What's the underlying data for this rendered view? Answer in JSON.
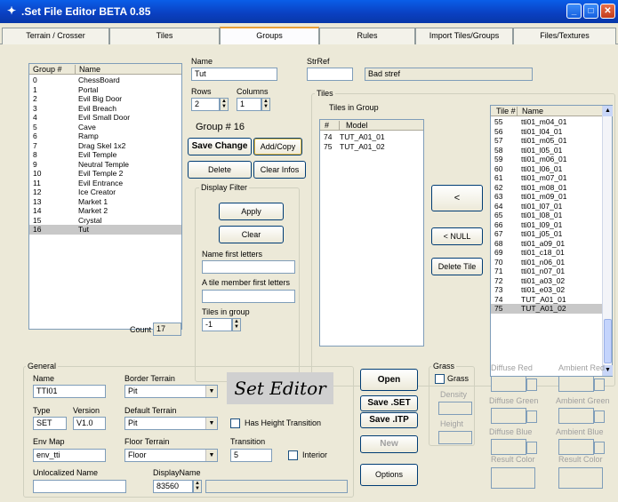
{
  "window": {
    "title": ".Set File Editor BETA 0.85",
    "app_icon": "wizard-icon"
  },
  "tabs": [
    "Terrain / Crosser",
    "Tiles",
    "Groups",
    "Rules",
    "Import Tiles/Groups",
    "Files/Textures"
  ],
  "groups": {
    "col_num": "Group #",
    "col_name": "Name",
    "rows": [
      [
        "0",
        "ChessBoard"
      ],
      [
        "1",
        "Portal"
      ],
      [
        "2",
        "Evil Big Door"
      ],
      [
        "3",
        "Evil Breach"
      ],
      [
        "4",
        "Evil Small Door"
      ],
      [
        "5",
        "Cave"
      ],
      [
        "6",
        "Ramp"
      ],
      [
        "7",
        "Drag Skel 1x2"
      ],
      [
        "8",
        "Evil Temple"
      ],
      [
        "9",
        "Neutral Temple"
      ],
      [
        "10",
        "Evil Temple 2"
      ],
      [
        "11",
        "Evil Entrance"
      ],
      [
        "12",
        "Ice Creator"
      ],
      [
        "13",
        "Market 1"
      ],
      [
        "14",
        "Market 2"
      ],
      [
        "15",
        "Crystal"
      ],
      [
        "16",
        "Tut"
      ]
    ],
    "count_label": "Count",
    "count": "17"
  },
  "edit": {
    "name_label": "Name",
    "name": "Tut",
    "strref_label": "StrRef",
    "strref": "",
    "strref_text": "Bad stref",
    "rows_label": "Rows",
    "rows": "2",
    "cols_label": "Columns",
    "cols": "1",
    "group_num": "Group # 16",
    "save_change": "Save Change",
    "add_copy": "Add/Copy",
    "delete": "Delete",
    "clear_infos": "Clear Infos"
  },
  "filter": {
    "title": "Display Filter",
    "apply": "Apply",
    "clear": "Clear",
    "name_first_label": "Name first letters",
    "member_label": "A tile member first letters",
    "tiles_in_group_label": "Tiles in group",
    "tiles_in_group": "-1"
  },
  "tiles": {
    "title": "Tiles",
    "in_group_title": "Tiles in Group",
    "col_num": "#",
    "col_model": "Model",
    "in_group": [
      [
        "74",
        "TUT_A01_01"
      ],
      [
        "75",
        "TUT_A01_02"
      ]
    ],
    "btn_add": "<",
    "btn_null": "< NULL",
    "btn_delete": "Delete Tile",
    "all_col_num": "Tile #",
    "all_col_name": "Name",
    "all": [
      [
        "55",
        "tti01_m04_01"
      ],
      [
        "56",
        "tti01_l04_01"
      ],
      [
        "57",
        "tti01_m05_01"
      ],
      [
        "58",
        "tti01_l05_01"
      ],
      [
        "59",
        "tti01_m06_01"
      ],
      [
        "60",
        "tti01_l06_01"
      ],
      [
        "61",
        "tti01_m07_01"
      ],
      [
        "62",
        "tti01_m08_01"
      ],
      [
        "63",
        "tti01_m09_01"
      ],
      [
        "64",
        "tti01_l07_01"
      ],
      [
        "65",
        "tti01_l08_01"
      ],
      [
        "66",
        "tti01_l09_01"
      ],
      [
        "67",
        "tti01_j05_01"
      ],
      [
        "68",
        "tti01_a09_01"
      ],
      [
        "69",
        "tti01_c18_01"
      ],
      [
        "70",
        "tti01_n06_01"
      ],
      [
        "71",
        "tti01_n07_01"
      ],
      [
        "72",
        "tti01_a03_02"
      ],
      [
        "73",
        "tti01_e03_02"
      ],
      [
        "74",
        "TUT_A01_01"
      ],
      [
        "75",
        "TUT_A01_02"
      ]
    ]
  },
  "general": {
    "title": "General",
    "name_label": "Name",
    "name": "TTI01",
    "border_label": "Border Terrain",
    "border": "Pit",
    "type_label": "Type",
    "type": "SET",
    "version_label": "Version",
    "version": "V1.0",
    "default_label": "Default Terrain",
    "default": "Pit",
    "has_height": "Has Height Transition",
    "env_label": "Env Map",
    "env": "env_tti",
    "floor_label": "Floor Terrain",
    "floor": "Floor",
    "transition_label": "Transition",
    "transition": "5",
    "interior": "Interior",
    "unloc_label": "Unlocalized Name",
    "unloc": "",
    "display_label": "DisplayName",
    "display": "83560",
    "logo": "Set Editor"
  },
  "actions": {
    "open": "Open",
    "save_set": "Save .SET",
    "save_itp": "Save .ITP",
    "new": "New",
    "options": "Options"
  },
  "grass": {
    "title": "Grass",
    "grass_chk": "Grass",
    "density": "Density",
    "height": "Height",
    "diffuse_red": "Diffuse Red",
    "diffuse_green": "Diffuse Green",
    "diffuse_blue": "Diffuse Blue",
    "ambient_red": "Ambient Red",
    "ambient_green": "Ambient Green",
    "ambient_blue": "Ambient Blue",
    "result_color": "Result Color",
    "result_color2": "Result Color"
  }
}
